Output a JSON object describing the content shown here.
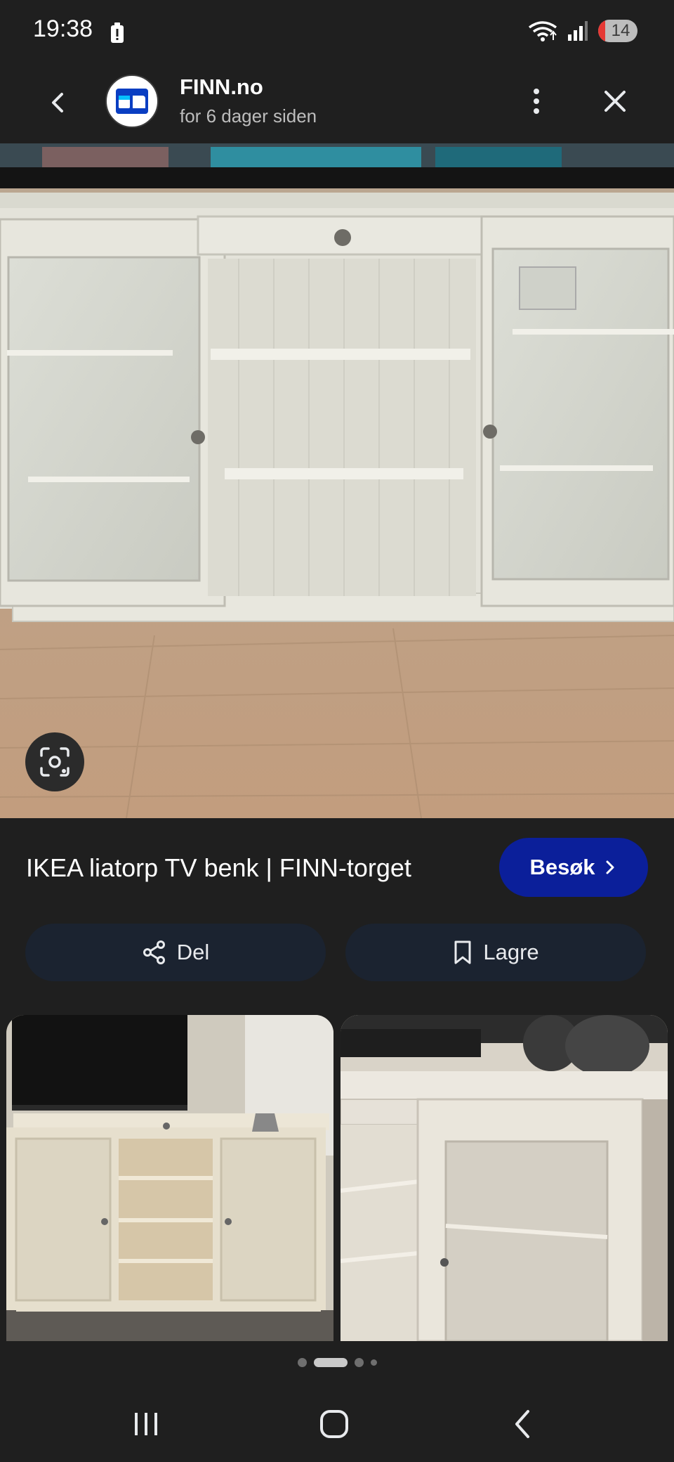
{
  "status_bar": {
    "time": "19:38",
    "battery_level": "14"
  },
  "header": {
    "site_name": "FINN.no",
    "posted": "for 6 dager siden"
  },
  "result": {
    "title": "IKEA liatorp TV benk | FINN-torget",
    "visit_label": "Besøk"
  },
  "actions": {
    "share_label": "Del",
    "save_label": "Lagre"
  },
  "colors": {
    "visit_button": "#0b1f9a",
    "action_button": "#1b2330",
    "background": "#1f1f1f"
  },
  "icons": [
    "battery-alert-icon",
    "wifi-icon",
    "signal-icon",
    "back-icon",
    "finn-logo-icon",
    "more-vert-icon",
    "close-icon",
    "lens-icon",
    "chevron-right-icon",
    "share-icon",
    "bookmark-icon",
    "recents-icon",
    "home-icon",
    "nav-back-icon"
  ],
  "carousel": {
    "page_count": 4,
    "active_page": 2
  }
}
